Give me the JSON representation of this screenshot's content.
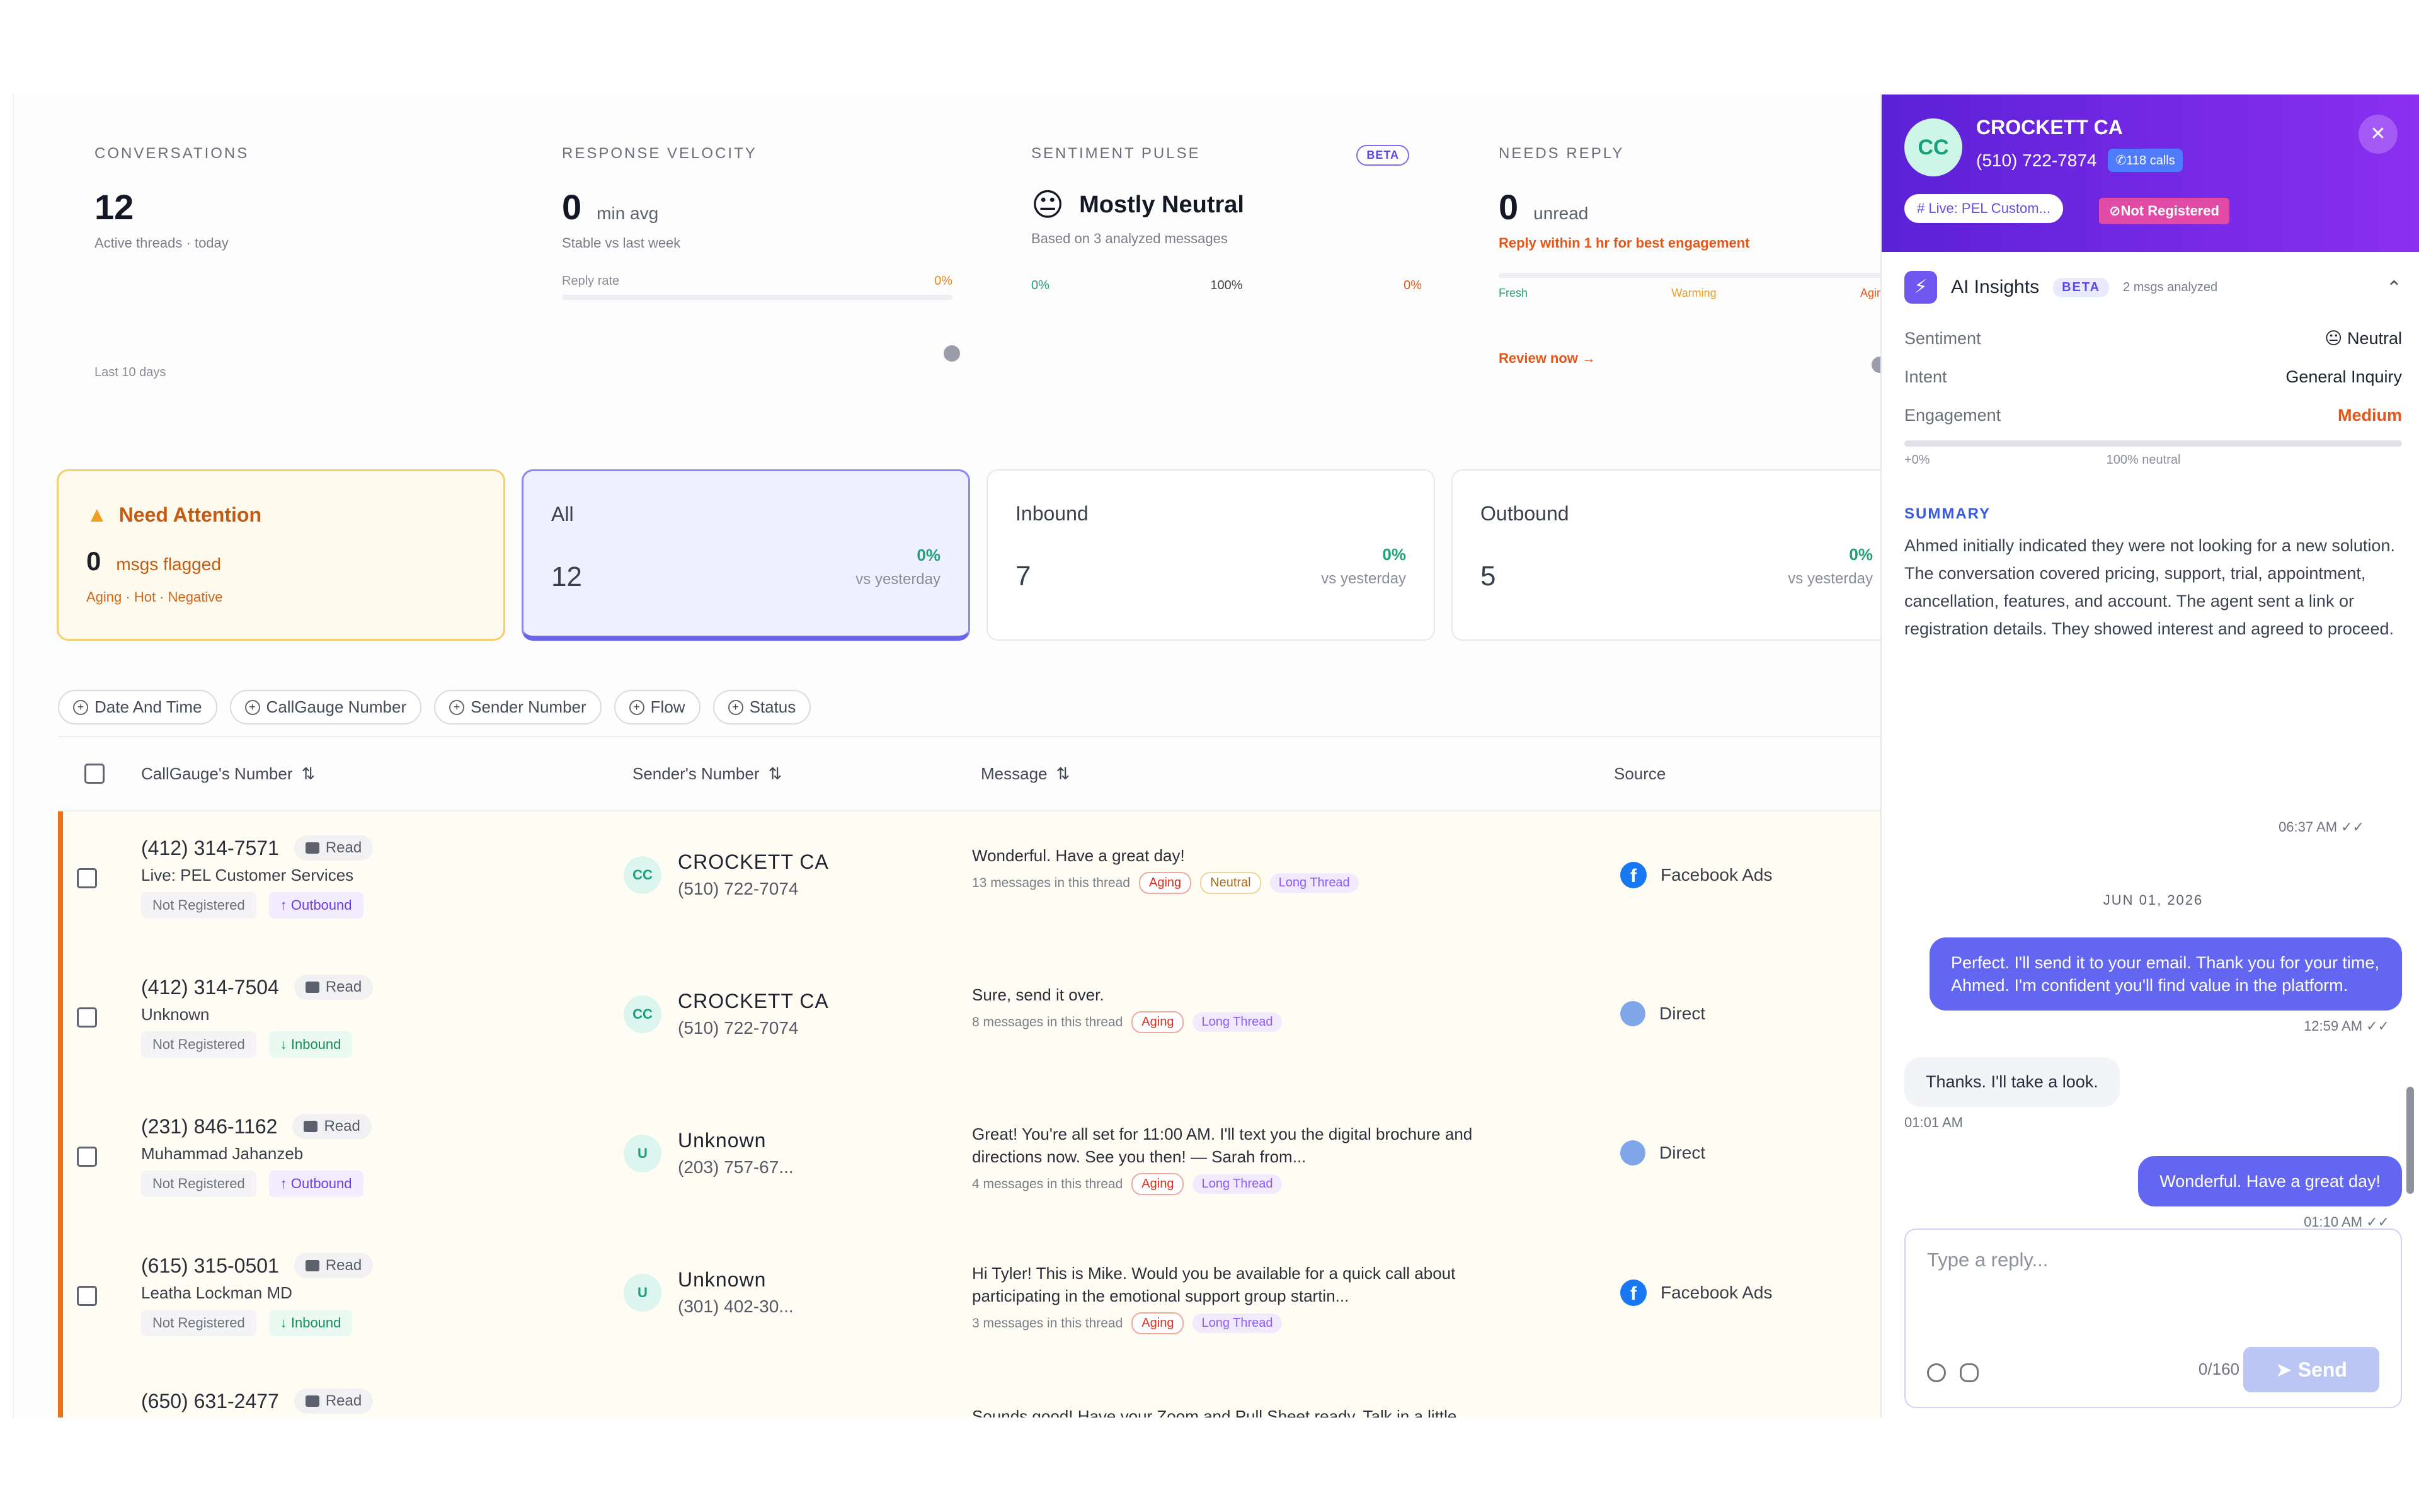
{
  "stats": [
    {
      "label": "CONVERSATIONS",
      "value": "12",
      "unit": "",
      "sub": "Active threads · today",
      "foot": "Last 10 days"
    },
    {
      "label": "RESPONSE VELOCITY",
      "value": "0",
      "unit": "min avg",
      "sub": "Stable vs last week",
      "mini_label": "Reply rate",
      "mini_value": "0%"
    },
    {
      "label": "SENTIMENT PULSE",
      "badge": "BETA",
      "value": "Mostly Neutral",
      "sub": "Based on 3 analyzed messages",
      "scale": [
        "0%",
        "100%",
        "0%"
      ]
    },
    {
      "label": "NEEDS REPLY",
      "value": "0",
      "unit": "unread",
      "sub": "Reply within 1 hr for best engagement",
      "scale": [
        "Fresh",
        "Warming",
        "Aging"
      ],
      "link": "Review now →"
    }
  ],
  "filter_cards": [
    {
      "title": "Need Attention",
      "count": "0",
      "unit": "msgs flagged",
      "meta": "Aging · Hot · Negative"
    },
    {
      "title": "All",
      "count": "12",
      "pct": "0%",
      "vs": "vs yesterday"
    },
    {
      "title": "Inbound",
      "count": "7",
      "pct": "0%",
      "vs": "vs yesterday"
    },
    {
      "title": "Outbound",
      "count": "5",
      "pct": "0%",
      "vs": "vs yesterday"
    }
  ],
  "chips": [
    "Date And Time",
    "CallGauge Number",
    "Sender Number",
    "Flow",
    "Status"
  ],
  "columns": [
    "CallGauge's Number",
    "Sender's Number",
    "Message",
    "Source"
  ],
  "rows": [
    {
      "phone": "(412) 314-7571",
      "read": "Read",
      "name": "Live: PEL Customer Services",
      "reg": "Not Registered",
      "dir": "↑ Outbound",
      "dir_type": "out",
      "av": "CC",
      "sender": "CROCKETT CA",
      "sender_phone": "(510) 722-7074",
      "msg": "Wonderful. Have a great day!",
      "meta": "13 messages in this thread",
      "pills": [
        "Aging",
        "Neutral",
        "Long Thread"
      ],
      "source": "Facebook Ads",
      "src_type": "fb"
    },
    {
      "phone": "(412) 314-7504",
      "read": "Read",
      "name": "Unknown",
      "reg": "Not Registered",
      "dir": "↓ Inbound",
      "dir_type": "in",
      "av": "CC",
      "sender": "CROCKETT CA",
      "sender_phone": "(510) 722-7074",
      "msg": "Sure, send it over.",
      "meta": "8 messages in this thread",
      "pills": [
        "Aging",
        "Long Thread"
      ],
      "source": "Direct",
      "src_type": "direct"
    },
    {
      "phone": "(231) 846-1162",
      "read": "Read",
      "name": "Muhammad Jahanzeb",
      "reg": "Not Registered",
      "dir": "↑ Outbound",
      "dir_type": "out",
      "av": "U",
      "sender": "Unknown",
      "sender_phone": "(203) 757-67...",
      "msg": "Great! You're all set for 11:00 AM. I'll text you the digital brochure and directions now. See you then! — Sarah from...",
      "meta": "4 messages in this thread",
      "pills": [
        "Aging",
        "Long Thread"
      ],
      "source": "Direct",
      "src_type": "direct"
    },
    {
      "phone": "(615) 315-0501",
      "read": "Read",
      "name": "Leatha Lockman MD",
      "reg": "Not Registered",
      "dir": "↓ Inbound",
      "dir_type": "in",
      "av": "U",
      "sender": "Unknown",
      "sender_phone": "(301) 402-30...",
      "msg": "Hi Tyler! This is Mike. Would you be available for a quick call about participating in the emotional support group startin...",
      "meta": "3 messages in this thread",
      "pills": [
        "Aging",
        "Long Thread"
      ],
      "source": "Facebook Ads",
      "src_type": "fb"
    },
    {
      "phone": "(650) 631-2477",
      "read": "Read",
      "name": "",
      "reg": "",
      "dir": "",
      "dir_type": "",
      "av": "",
      "sender": "",
      "sender_phone": "",
      "msg": "Sounds good! Have your Zoom and Pull Sheet ready, Talk in a little",
      "meta": "",
      "pills": [],
      "source": "",
      "src_type": ""
    }
  ],
  "panel": {
    "avatar": "CC",
    "name": "CROCKETT CA",
    "phone": "(510) 722-7874",
    "calls": "118 calls",
    "live_tag": "# Live: PEL Custom...",
    "reg_tag": "Not Registered",
    "ai_title": "AI Insights",
    "ai_badge": "BETA",
    "ai_count": "2 msgs analyzed",
    "sentiment_label": "Sentiment",
    "sentiment_value": "Neutral",
    "intent_label": "Intent",
    "intent_value": "General Inquiry",
    "engagement_label": "Engagement",
    "engagement_value": "Medium",
    "eng_scale_left": "+0%",
    "eng_scale_mid": "100% neutral",
    "summary_title": "SUMMARY",
    "summary": "Ahmed initially indicated they were not looking for a new solution. The conversation covered pricing, support, trial, appointment, cancellation, features, and account. The agent sent a link or registration details. They showed interest and agreed to proceed.",
    "t1": "06:37 AM",
    "date": "JUN 01, 2026",
    "m1": "Perfect. I'll send it to your email. Thank you for your time, Ahmed. I'm confident you'll find value in the platform.",
    "t2": "12:59 AM",
    "m2": "Thanks. I'll take a look.",
    "t3": "01:01 AM",
    "m3": "Wonderful. Have a great day!",
    "t4": "01:10 AM",
    "reply_placeholder": "Type a reply...",
    "counter": "0/160",
    "send": "Send"
  }
}
